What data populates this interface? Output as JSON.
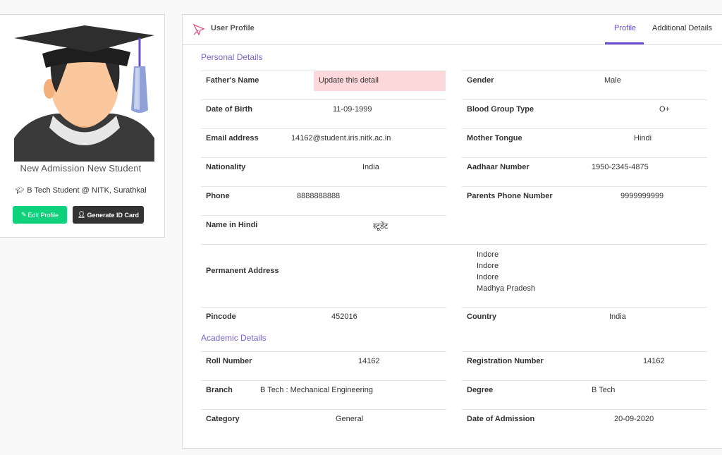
{
  "profile_card": {
    "name": "New Admission New Student",
    "subtitle": "B Tech Student @ NITK, Surathkal",
    "edit_button": "Edit Profile",
    "id_card_button": "Generate ID Card"
  },
  "header": {
    "title": "User Profile",
    "tabs": [
      "Profile",
      "Additional Details"
    ]
  },
  "personal": {
    "section_title": "Personal Details",
    "fathers_name": {
      "label": "Father's Name",
      "value": "Update this detail"
    },
    "gender": {
      "label": "Gender",
      "value": "Male"
    },
    "dob": {
      "label": "Date of Birth",
      "value": "11-09-1999"
    },
    "blood_group": {
      "label": "Blood Group Type",
      "value": "O+"
    },
    "email": {
      "label": "Email address",
      "value": "14162@student.iris.nitk.ac.in"
    },
    "mother_tongue": {
      "label": "Mother Tongue",
      "value": "Hindi"
    },
    "nationality": {
      "label": "Nationality",
      "value": "India"
    },
    "aadhaar": {
      "label": "Aadhaar Number",
      "value": "1950-2345-4875"
    },
    "phone": {
      "label": "Phone",
      "value": "8888888888"
    },
    "parents_phone": {
      "label": "Parents Phone Number",
      "value": "9999999999"
    },
    "name_hindi": {
      "label": "Name in Hindi",
      "value": "स्टूडेंट"
    },
    "permanent_address": {
      "label": "Permanent Address",
      "lines": [
        "Indore",
        "Indore",
        "Indore",
        "Madhya Pradesh"
      ]
    },
    "pincode": {
      "label": "Pincode",
      "value": "452016"
    },
    "country": {
      "label": "Country",
      "value": "India"
    }
  },
  "academic": {
    "section_title": "Academic Details",
    "roll_number": {
      "label": "Roll Number",
      "value": "14162"
    },
    "registration_number": {
      "label": "Registration Number",
      "value": "14162"
    },
    "branch": {
      "label": "Branch",
      "value": "B Tech : Mechanical Engineering"
    },
    "degree": {
      "label": "Degree",
      "value": "B Tech"
    },
    "category": {
      "label": "Category",
      "value": "General"
    },
    "date_of_admission": {
      "label": "Date of Admission",
      "value": "20-09-2020"
    }
  },
  "colors": {
    "accent": "#6c4fd0",
    "edit_button": "#0fd17b",
    "highlight": "#fdd8da"
  }
}
